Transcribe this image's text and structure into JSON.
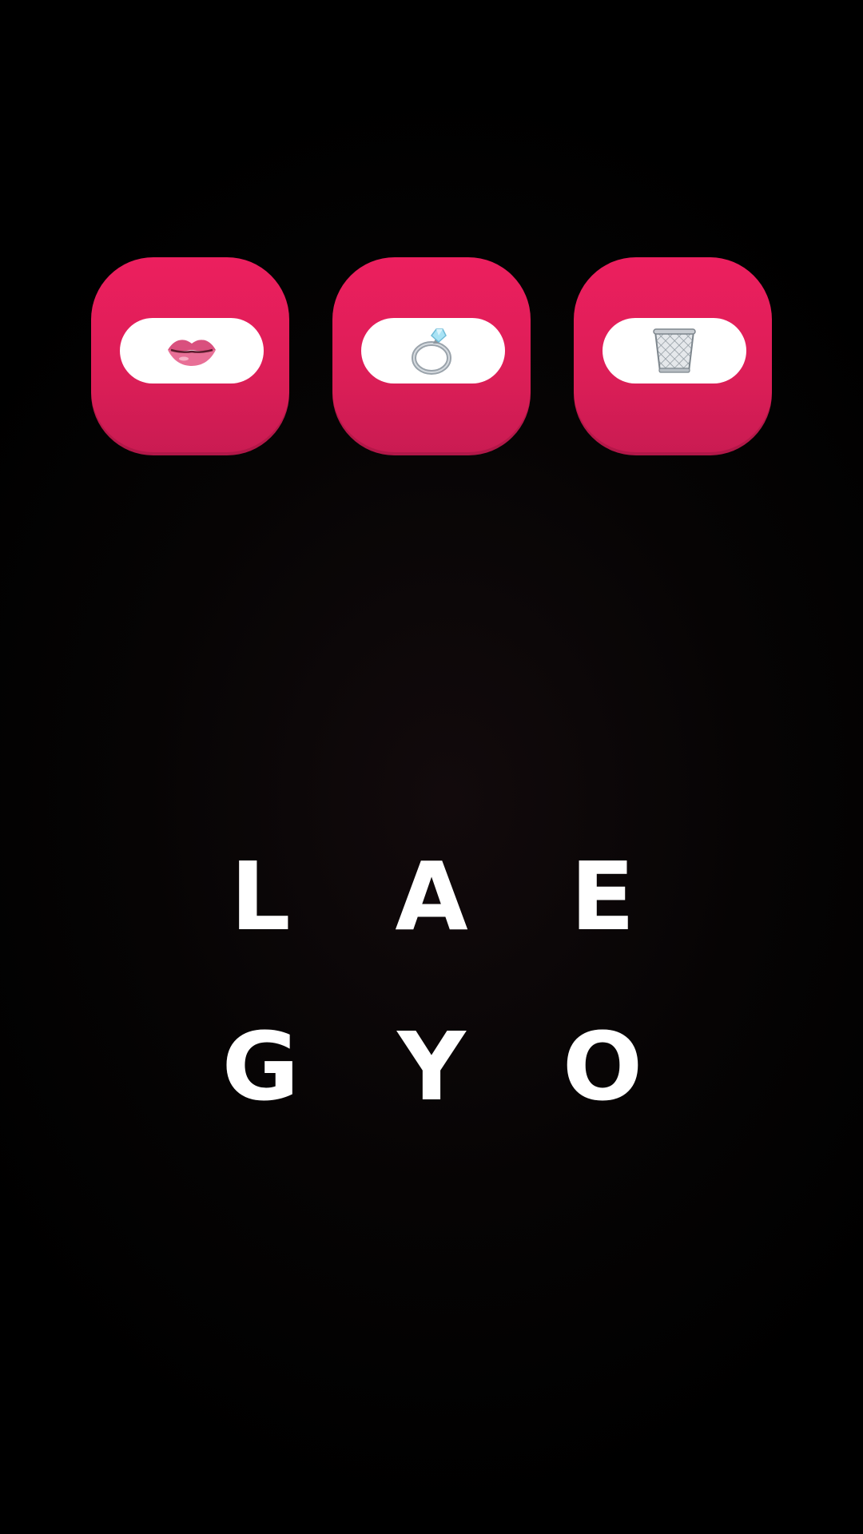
{
  "clue_tiles": [
    {
      "icon": "lips-icon",
      "glyph": "👄"
    },
    {
      "icon": "ring-icon",
      "glyph": "💍"
    },
    {
      "icon": "wastebasket-icon",
      "glyph": "🗑️"
    }
  ],
  "letters": {
    "row1": [
      "L",
      "A",
      "E"
    ],
    "row2": [
      "G",
      "Y",
      "O"
    ]
  },
  "colors": {
    "tile": "#e91e5c",
    "pill": "#ffffff",
    "letter": "#ffffff",
    "background": "#000000"
  }
}
